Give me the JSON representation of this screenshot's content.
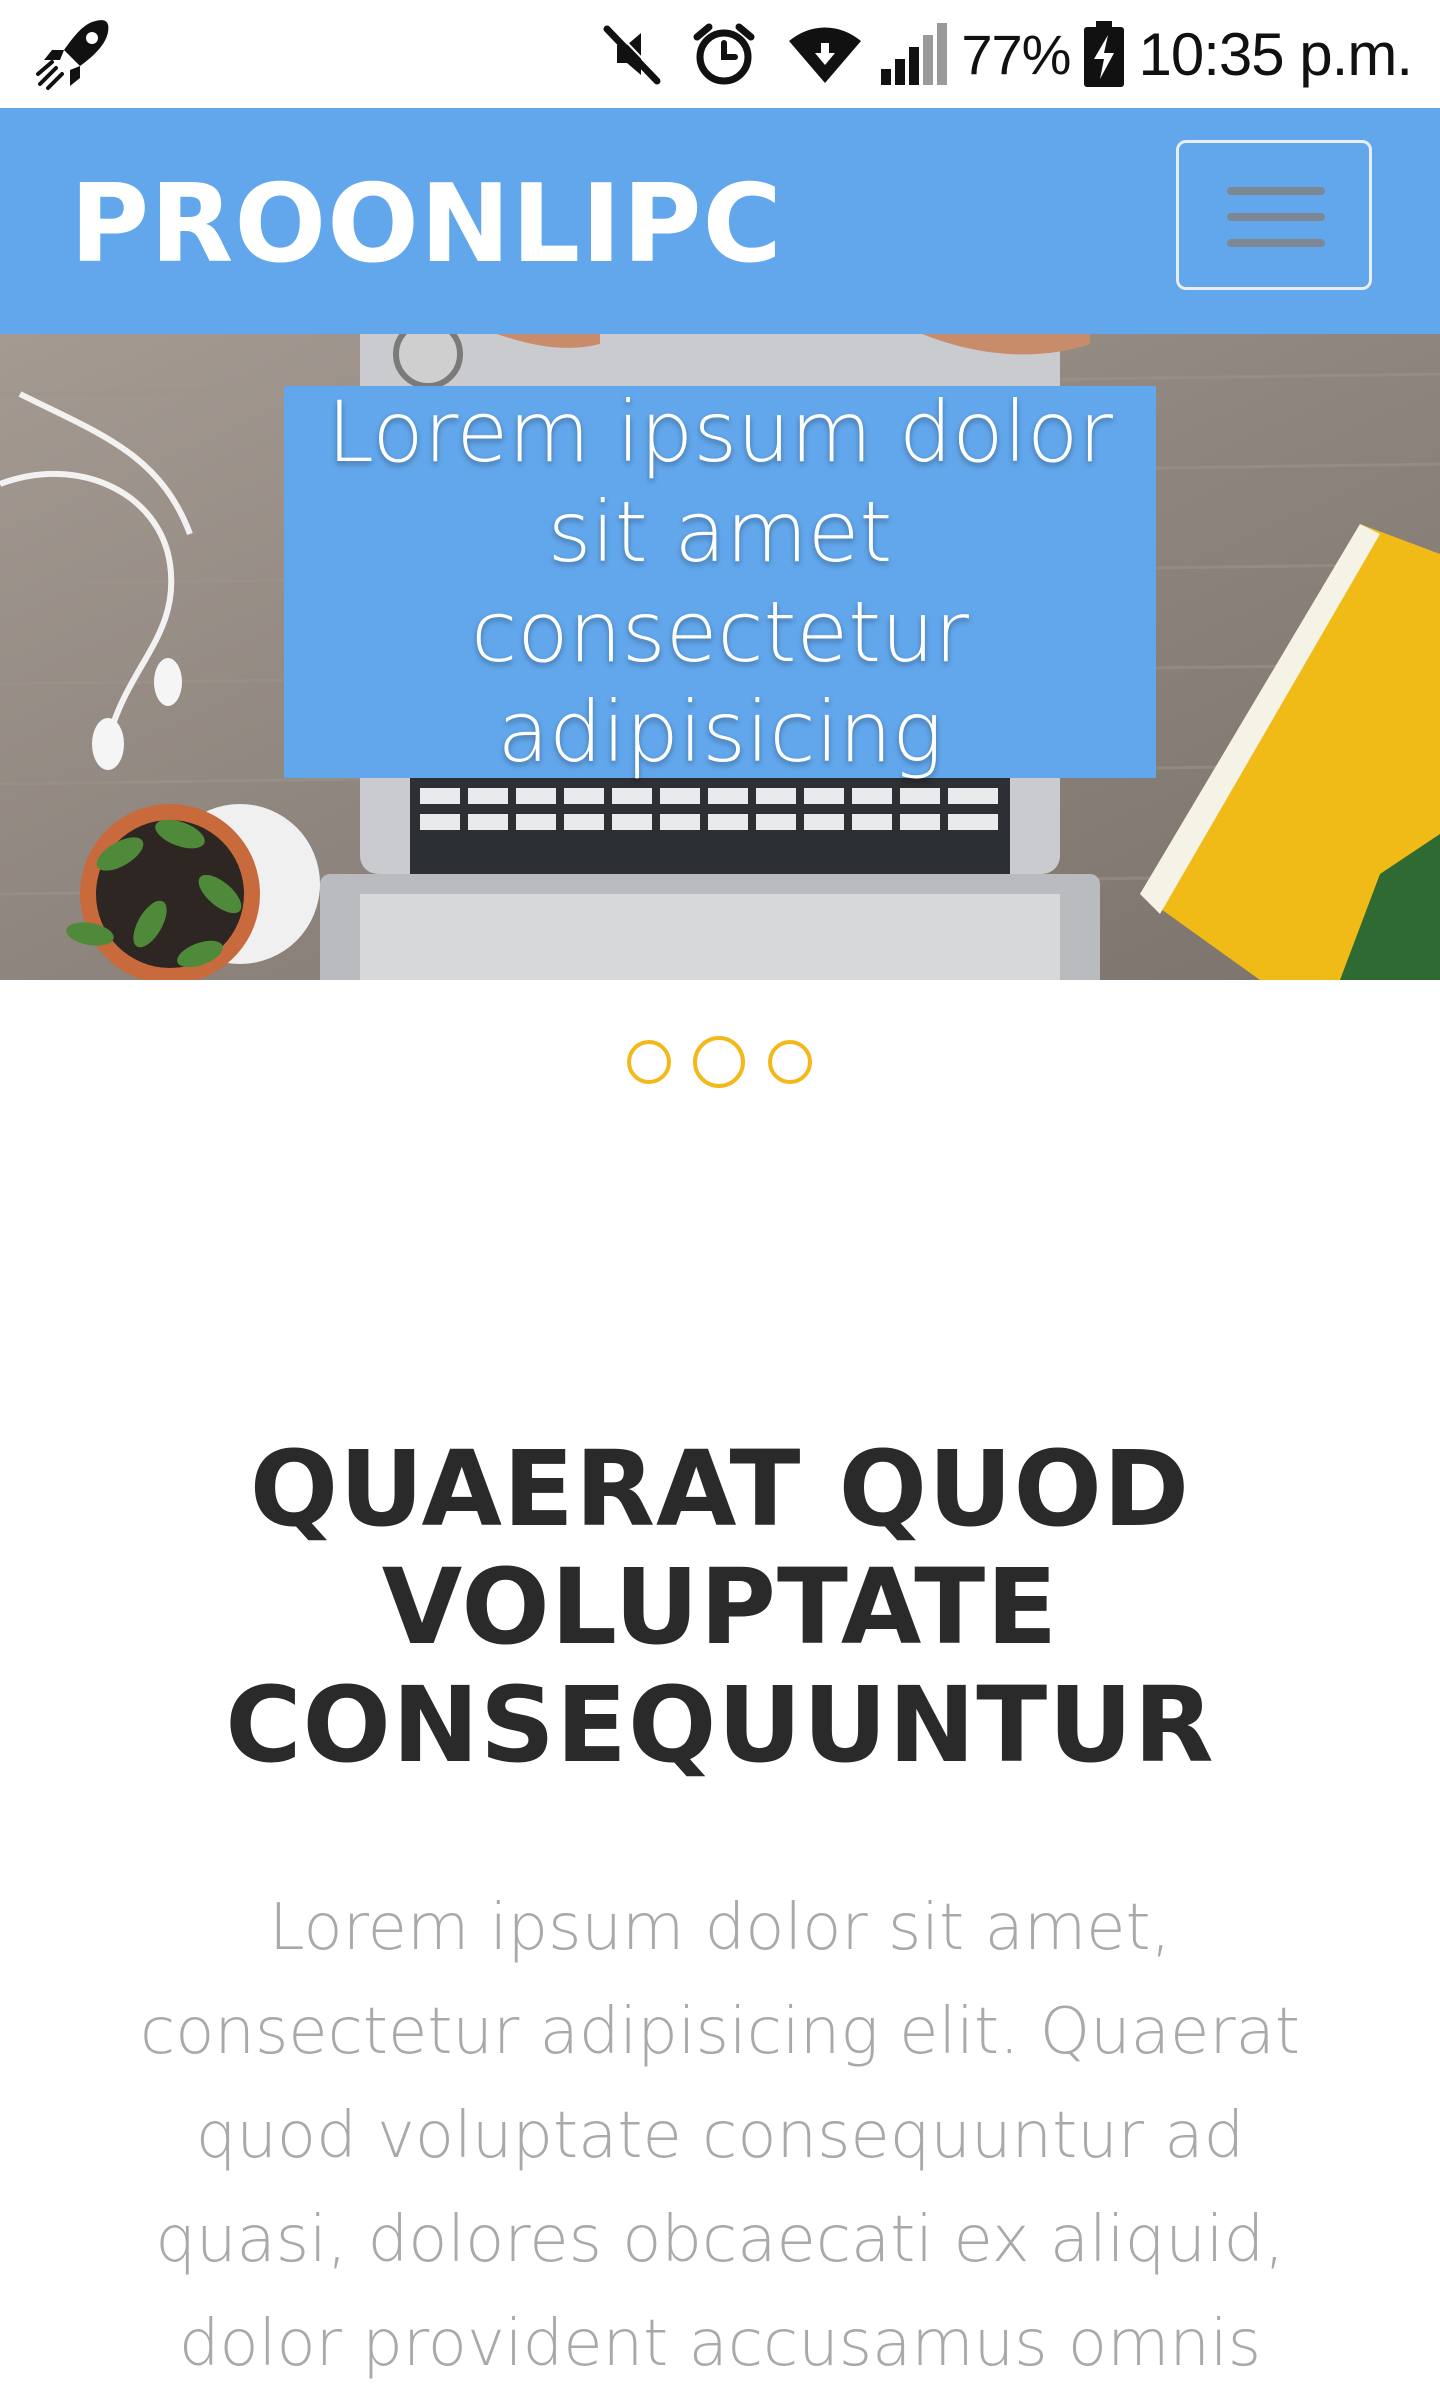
{
  "status_bar": {
    "battery_percent": "77%",
    "time": "10:35 p.m.",
    "icons": [
      "rocket-icon",
      "mute-icon",
      "alarm-icon",
      "wifi-icon",
      "signal-icon",
      "battery-charging-icon"
    ]
  },
  "navbar": {
    "brand": "PROONLIPC",
    "menu_icon": "hamburger-menu-icon",
    "background_color": "#62a7ec"
  },
  "hero": {
    "caption": "Lorem ipsum dolor sit amet consectetur adipisicing",
    "slide_count": 3,
    "active_slide": 2,
    "indicator_color": "#f3b81a"
  },
  "main": {
    "heading": "QUAERAT QUOD VOLUPTATE CONSEQUUNTUR",
    "body": "Lorem ipsum dolor sit amet, consectetur adipisicing elit. Quaerat quod voluptate consequuntur ad quasi, dolores obcaecati ex aliquid, dolor provident accusamus omnis"
  }
}
